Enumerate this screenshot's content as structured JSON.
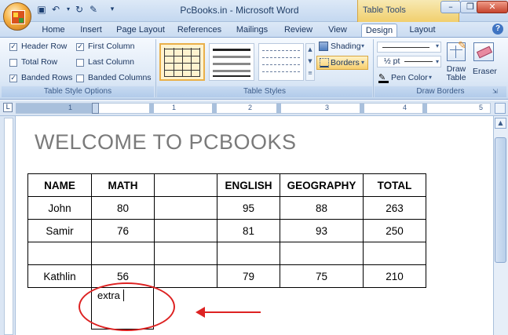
{
  "window": {
    "title": "PcBooks.in - Microsoft Word",
    "contextual_tab_group": "Table Tools"
  },
  "tabs": [
    {
      "label": "Home"
    },
    {
      "label": "Insert"
    },
    {
      "label": "Page Layout"
    },
    {
      "label": "References"
    },
    {
      "label": "Mailings"
    },
    {
      "label": "Review"
    },
    {
      "label": "View"
    },
    {
      "label": "Design",
      "active": true
    },
    {
      "label": "Layout"
    }
  ],
  "ribbon": {
    "table_style_options": {
      "group_label": "Table Style Options",
      "checkboxes": [
        {
          "label": "Header Row",
          "checked": true
        },
        {
          "label": "First Column",
          "checked": true
        },
        {
          "label": "Total Row",
          "checked": false
        },
        {
          "label": "Last Column",
          "checked": false
        },
        {
          "label": "Banded Rows",
          "checked": true
        },
        {
          "label": "Banded Columns",
          "checked": false
        }
      ]
    },
    "table_styles": {
      "group_label": "Table Styles",
      "shading_label": "Shading",
      "borders_label": "Borders"
    },
    "draw_borders": {
      "group_label": "Draw Borders",
      "pen_weight": "½ pt",
      "pen_color_label": "Pen Color",
      "draw_table_label": "Draw Table",
      "eraser_label": "Eraser"
    },
    "colors": {
      "accent": "#e9b04a",
      "ribbon": "#dce8f6"
    }
  },
  "ruler": {
    "numbers": [
      "1",
      "1",
      "2",
      "3",
      "4",
      "5"
    ]
  },
  "document": {
    "heading": "WELCOME TO PCBOOKS",
    "table": {
      "headers": [
        "NAME",
        "MATH",
        "",
        "ENGLISH",
        "GEOGRAPHY",
        "TOTAL"
      ],
      "rows": [
        [
          "John",
          "80",
          "",
          "95",
          "88",
          "263"
        ],
        [
          "Samir",
          "76",
          "",
          "81",
          "93",
          "250"
        ],
        [
          "",
          "",
          "",
          "",
          "",
          ""
        ],
        [
          "Kathlin",
          "56",
          "",
          "79",
          "75",
          "210"
        ]
      ]
    },
    "extra_cell_text": "extra",
    "annotation_color": "#dd2222"
  }
}
